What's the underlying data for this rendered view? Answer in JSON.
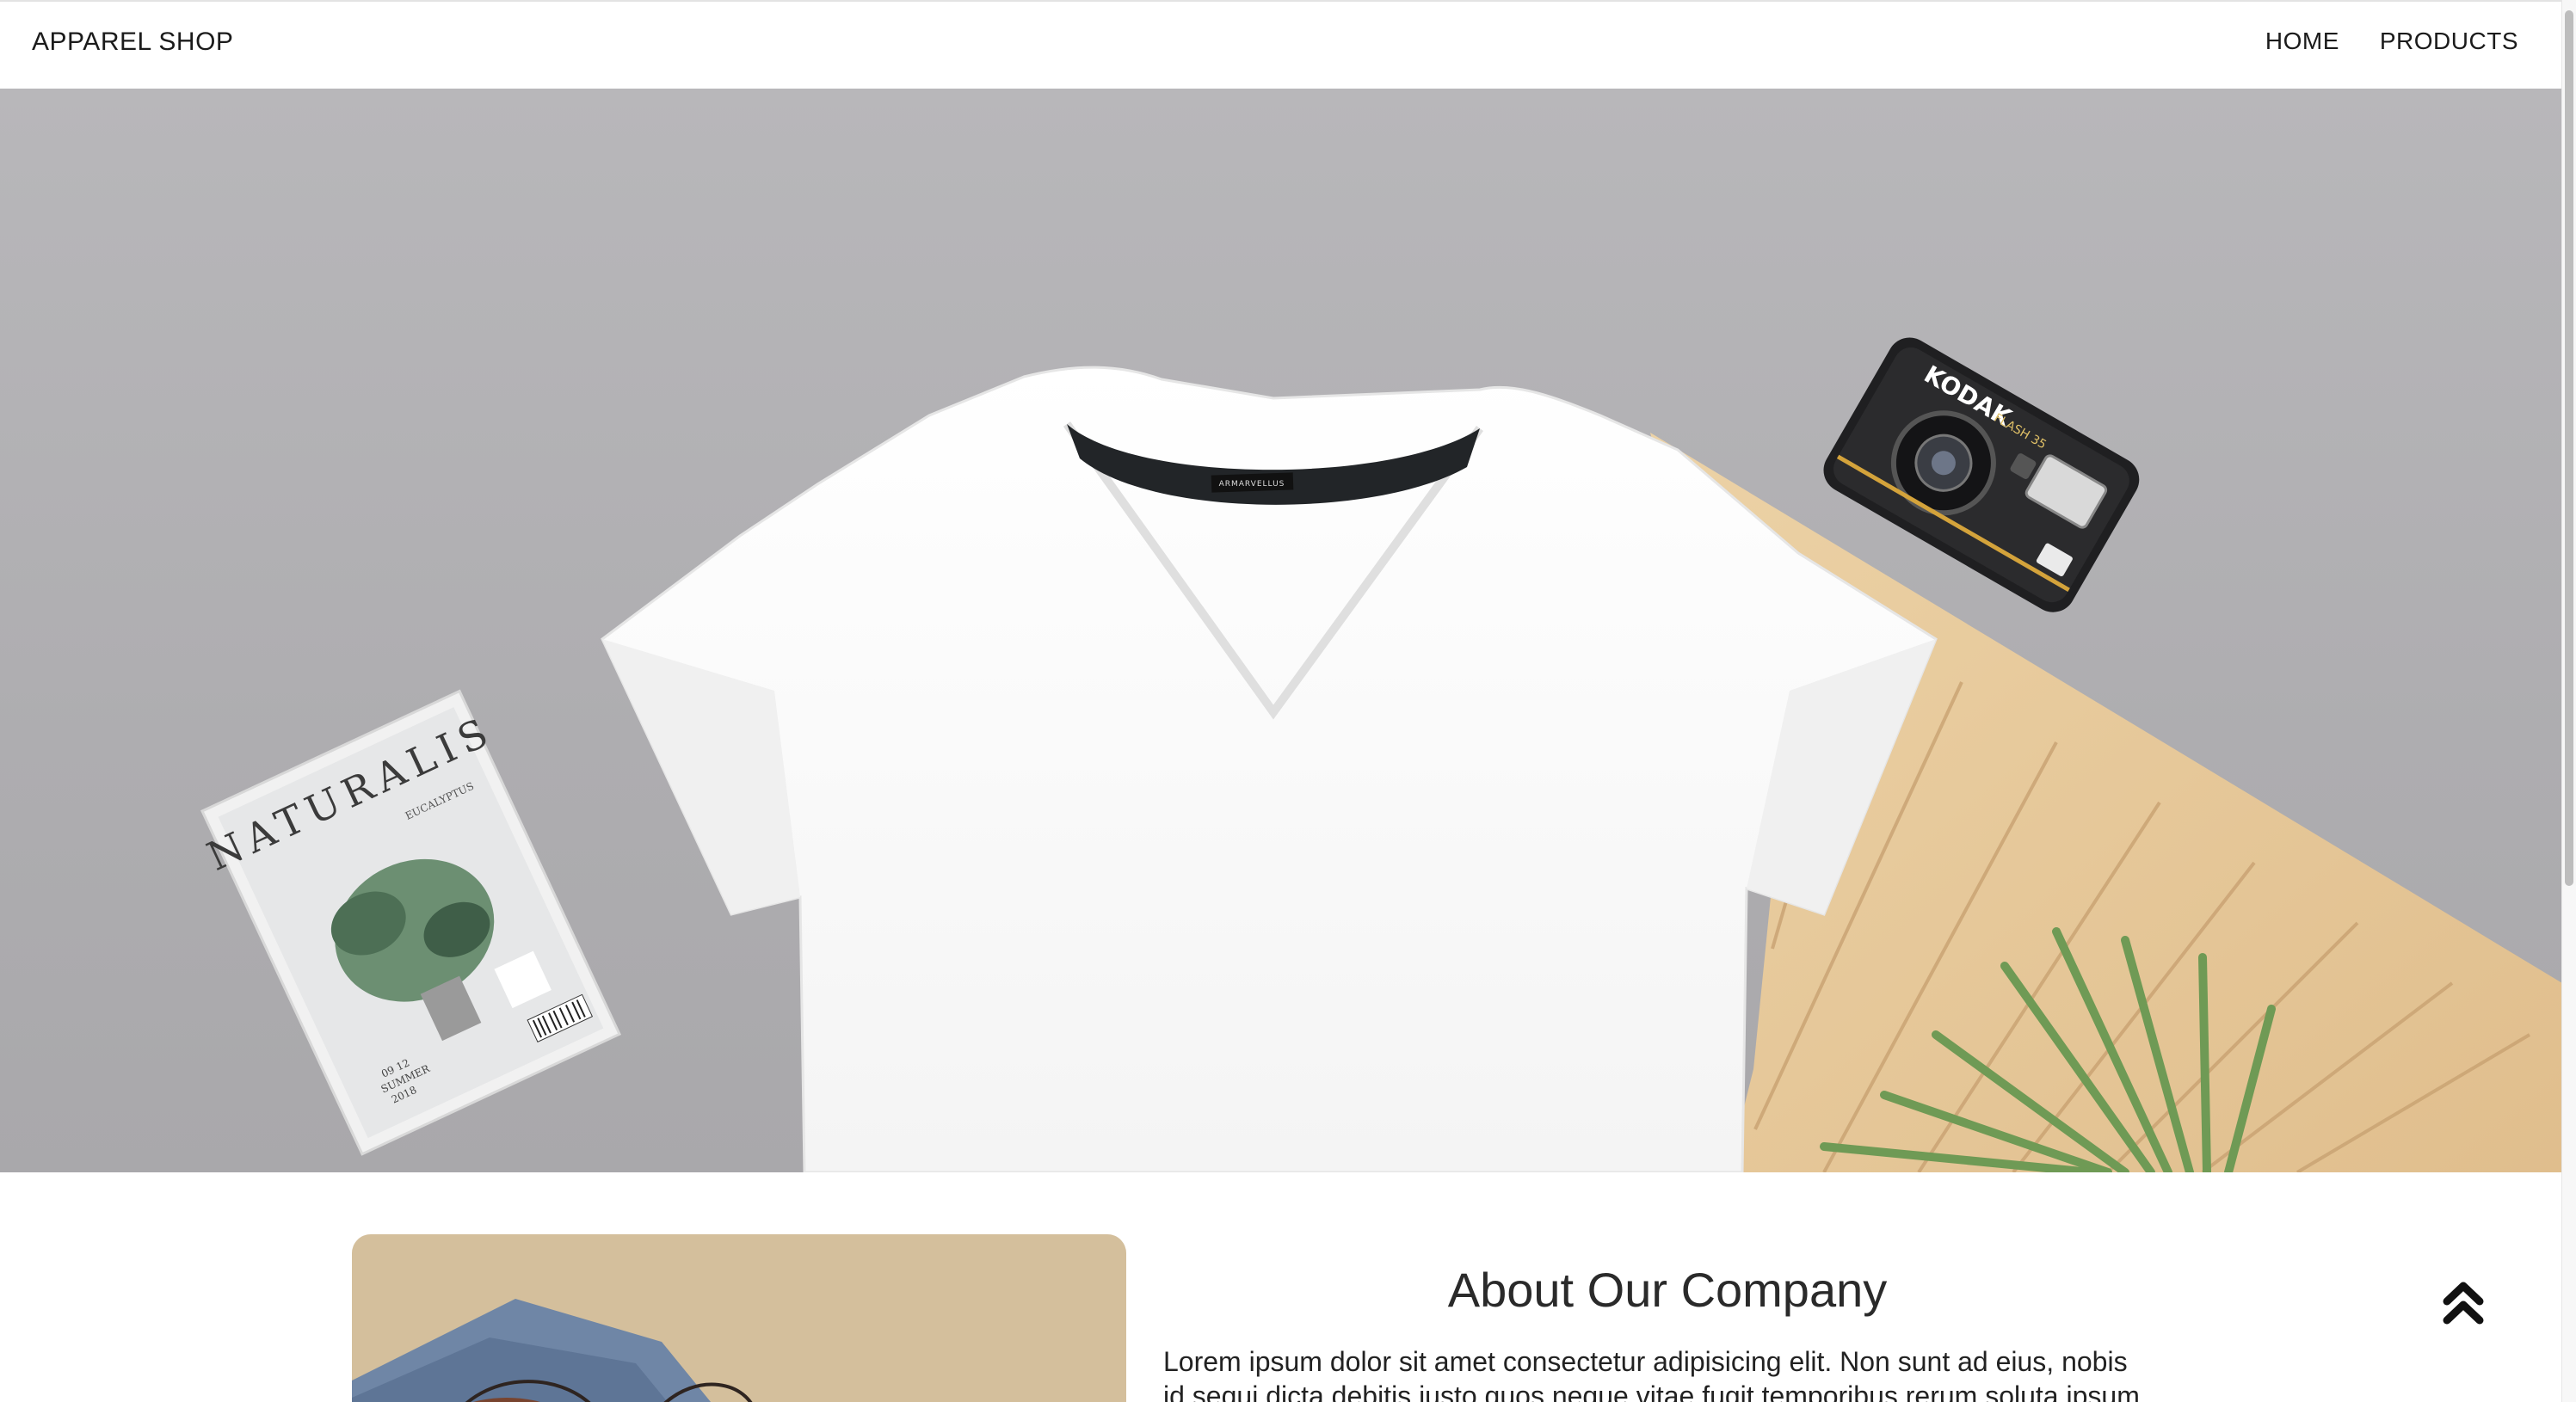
{
  "navbar": {
    "brand": "APPAREL SHOP",
    "links": [
      "HOME",
      "PRODUCTS"
    ]
  },
  "hero": {
    "magazine_title": "NATURALIS",
    "magazine_section": "EUCALYPTUS",
    "magazine_date": "09 12",
    "magazine_season": "SUMMER",
    "magazine_year": "2018",
    "shirt_label": "ARMARVELLUS",
    "camera_brand": "KODAK",
    "camera_model": "FLASH 35"
  },
  "about": {
    "title": "About Our Company",
    "text": "Lorem ipsum dolor sit amet consectetur adipisicing elit. Non sunt ad eius, nobis id sequi dicta debitis iusto quos neque vitae fugit temporibus rerum soluta ipsum atque"
  },
  "icons": {
    "to_top": "double-chevron-up-icon"
  },
  "colors": {
    "hero_background": "#b1b0b3",
    "nav_text": "#1b1b1b",
    "wood": "#e6c99c"
  }
}
